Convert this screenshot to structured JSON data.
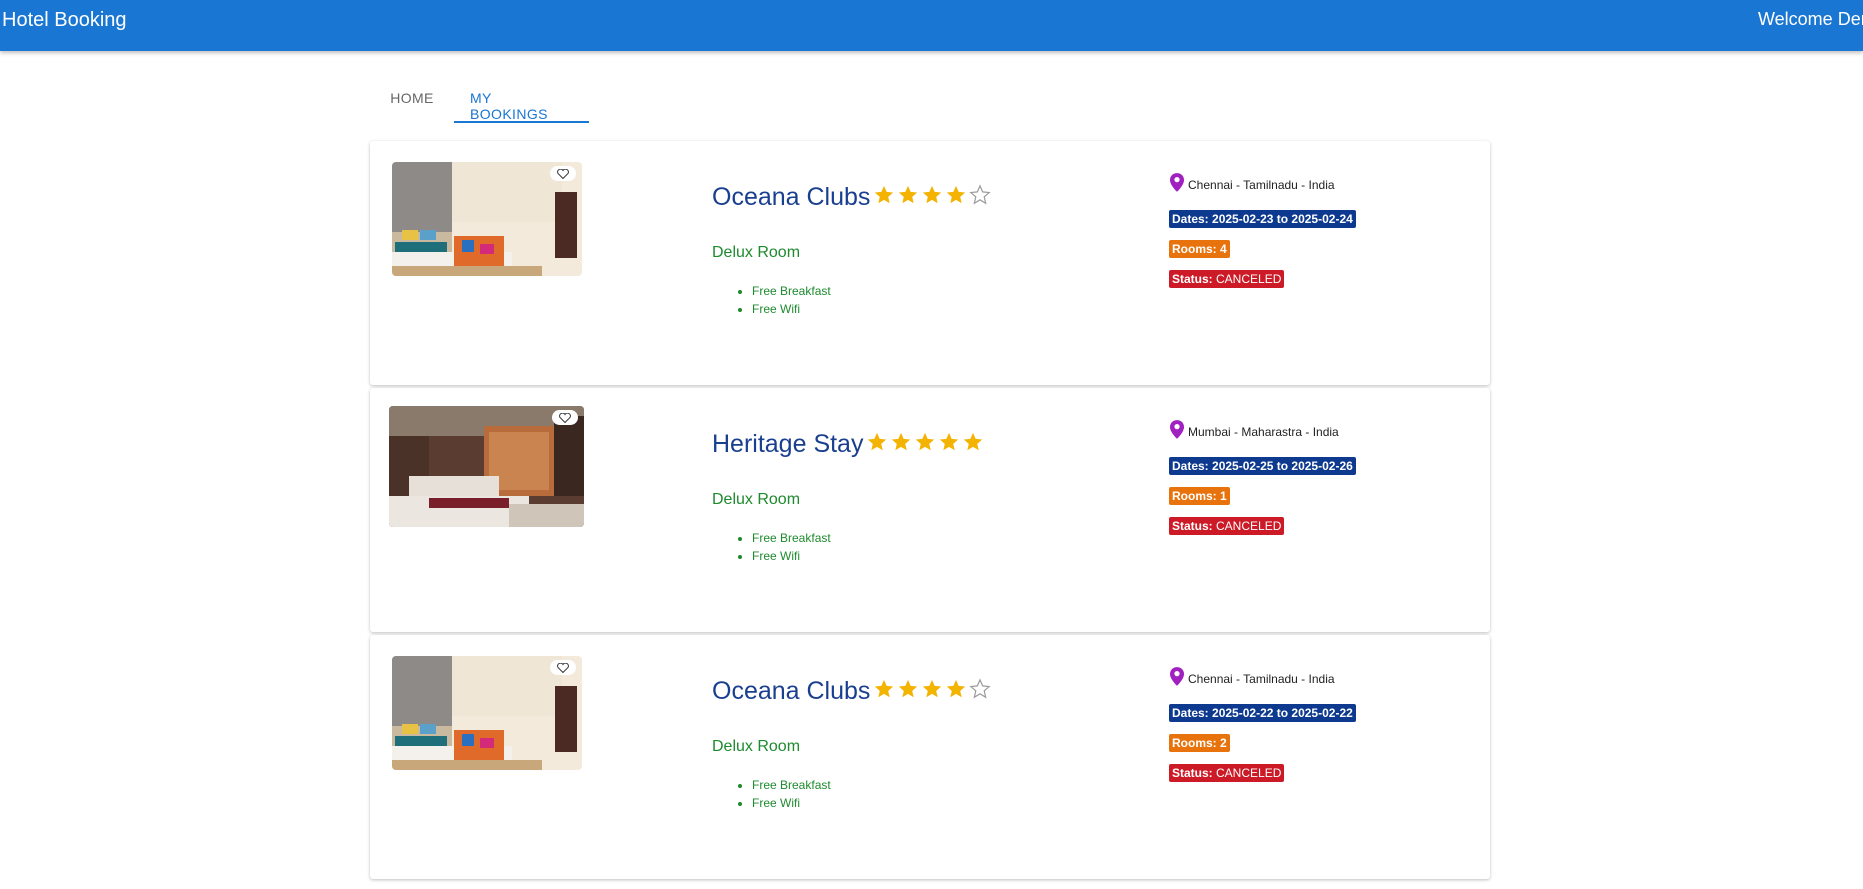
{
  "app": {
    "title": "Hotel Booking",
    "welcome": "Welcome Dem"
  },
  "tabs": [
    {
      "label": "HOME",
      "active": false
    },
    {
      "label": "MY BOOKINGS",
      "active": true
    }
  ],
  "colors": {
    "appbar": "#1976d2",
    "star": "#f5b301",
    "pin": "#a020c0",
    "dates": "#0d3a8f",
    "rooms": "#e8720c",
    "status": "#cc1a26"
  },
  "bookings": [
    {
      "hotel": "Oceana Clubs",
      "rating": 4,
      "max_rating": 5,
      "room": "Delux Room",
      "amenities": [
        "Free Breakfast",
        "Free Wifi"
      ],
      "location": "Chennai - Tamilnadu - India",
      "dates_label": "Dates:",
      "dates": "2025-02-23 to 2025-02-24",
      "rooms_label": "Rooms:",
      "rooms": "4",
      "status_label": "Status:",
      "status": "CANCELED"
    },
    {
      "hotel": "Heritage Stay",
      "rating": 5,
      "max_rating": 5,
      "room": "Delux Room",
      "amenities": [
        "Free Breakfast",
        "Free Wifi"
      ],
      "location": "Mumbai - Maharastra - India",
      "dates_label": "Dates:",
      "dates": "2025-02-25 to 2025-02-26",
      "rooms_label": "Rooms:",
      "rooms": "1",
      "status_label": "Status:",
      "status": "CANCELED"
    },
    {
      "hotel": "Oceana Clubs",
      "rating": 4,
      "max_rating": 5,
      "room": "Delux Room",
      "amenities": [
        "Free Breakfast",
        "Free Wifi"
      ],
      "location": "Chennai - Tamilnadu - India",
      "dates_label": "Dates:",
      "dates": "2025-02-22 to 2025-02-22",
      "rooms_label": "Rooms:",
      "rooms": "2",
      "status_label": "Status:",
      "status": "CANCELED"
    }
  ]
}
